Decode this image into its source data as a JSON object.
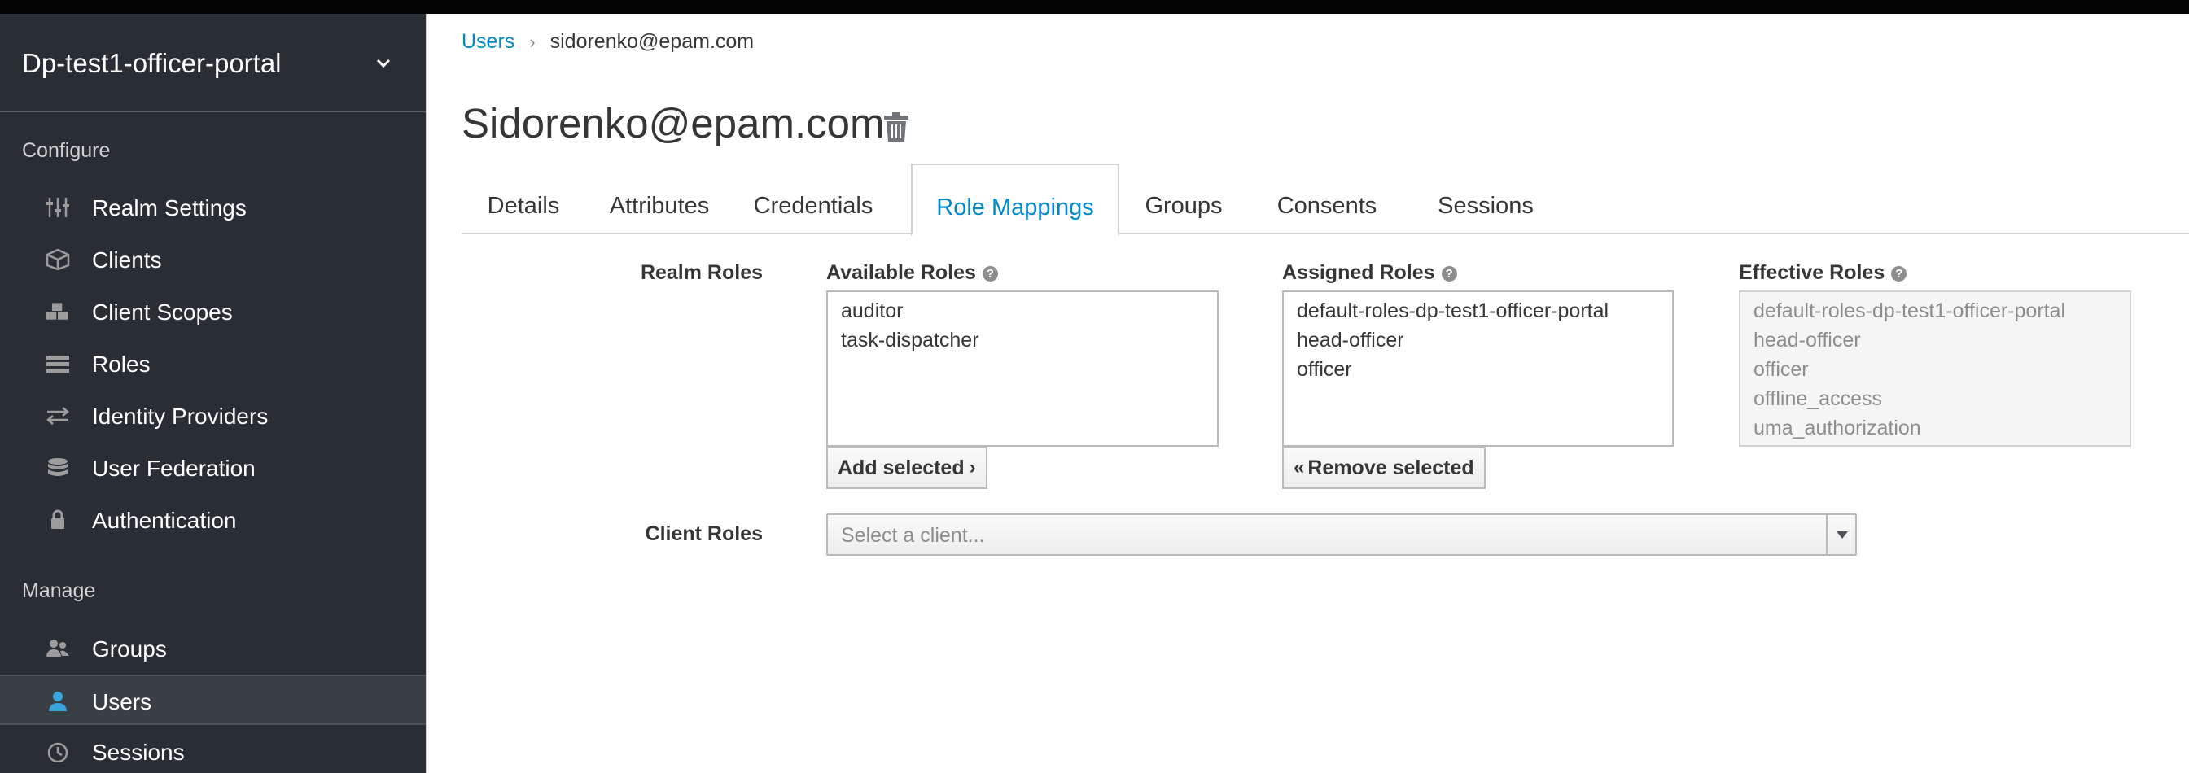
{
  "sidebar": {
    "realm_name": "Dp-test1-officer-portal",
    "configure_title": "Configure",
    "configure_items": [
      {
        "label": "Realm Settings",
        "icon": "sliders-icon"
      },
      {
        "label": "Clients",
        "icon": "cube-icon"
      },
      {
        "label": "Client Scopes",
        "icon": "cubes-icon"
      },
      {
        "label": "Roles",
        "icon": "list-icon"
      },
      {
        "label": "Identity Providers",
        "icon": "exchange-icon"
      },
      {
        "label": "User Federation",
        "icon": "database-icon"
      },
      {
        "label": "Authentication",
        "icon": "lock-icon"
      }
    ],
    "manage_title": "Manage",
    "manage_items": [
      {
        "label": "Groups",
        "icon": "users-icon"
      },
      {
        "label": "Users",
        "icon": "user-icon",
        "active": true
      },
      {
        "label": "Sessions",
        "icon": "clock-icon"
      }
    ]
  },
  "breadcrumb": {
    "parent": "Users",
    "current": "sidorenko@epam.com"
  },
  "page": {
    "title": "Sidorenko@epam.com"
  },
  "tabs": [
    {
      "label": "Details"
    },
    {
      "label": "Attributes"
    },
    {
      "label": "Credentials"
    },
    {
      "label": "Role Mappings",
      "active": true
    },
    {
      "label": "Groups"
    },
    {
      "label": "Consents"
    },
    {
      "label": "Sessions"
    }
  ],
  "role_mappings": {
    "realm_roles_label": "Realm Roles",
    "available_label": "Available Roles",
    "assigned_label": "Assigned Roles",
    "effective_label": "Effective Roles",
    "available_roles": [
      "auditor",
      "task-dispatcher"
    ],
    "assigned_roles": [
      "default-roles-dp-test1-officer-portal",
      "head-officer",
      "officer"
    ],
    "effective_roles": [
      "default-roles-dp-test1-officer-portal",
      "head-officer",
      "officer",
      "offline_access",
      "uma_authorization"
    ],
    "add_selected_label": "Add selected",
    "remove_selected_label": "Remove selected",
    "client_roles_label": "Client Roles",
    "client_select_placeholder": "Select a client..."
  },
  "colors": {
    "sidebar_bg": "#292e34",
    "accent": "#0088ce",
    "active_icon": "#39a5dc"
  }
}
